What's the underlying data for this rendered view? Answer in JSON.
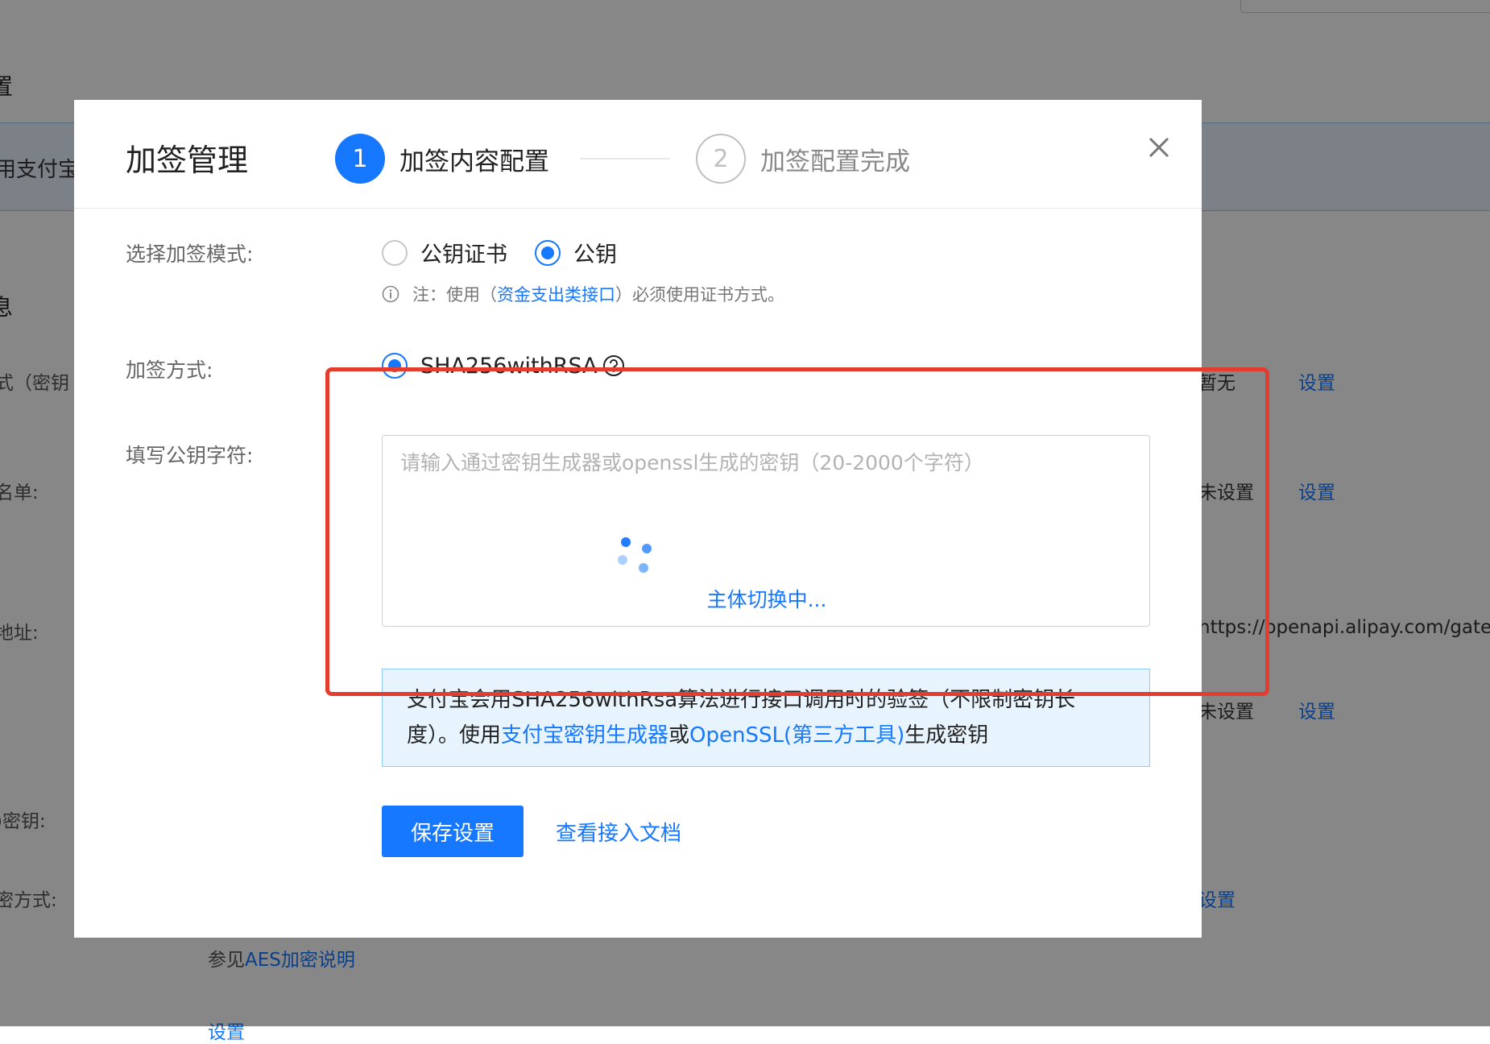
{
  "background": {
    "title_fragment": "置",
    "banner_text": "用支付宝",
    "section_fragment": "息",
    "rows": [
      {
        "label": "式（密钥",
        "value": "暂无",
        "action": "设置"
      },
      {
        "label": "名单:",
        "value": "未设置",
        "action": "设置"
      },
      {
        "label": "地址:",
        "value": "https://openapi.alipay.com/gateway"
      },
      {
        "label": "",
        "value": "未设置",
        "action": "设置"
      },
      {
        "label": ")密钥:"
      },
      {
        "label": "密方式:",
        "action": "设置"
      }
    ],
    "aes_note_prefix": "参见",
    "aes_note_link": "AES加密说明",
    "bottom_fragment": "设置"
  },
  "modal": {
    "title": "加签管理",
    "steps": [
      {
        "number": "1",
        "label": "加签内容配置"
      },
      {
        "number": "2",
        "label": "加签配置完成"
      }
    ],
    "close_icon": "close-icon",
    "mode": {
      "label": "选择加签模式:",
      "options": [
        "公钥证书",
        "公钥"
      ],
      "selected": "公钥"
    },
    "note": {
      "prefix": "注：使用（",
      "link": "资金支出类接口",
      "suffix": "）必须使用证书方式。"
    },
    "method": {
      "label": "加签方式:",
      "option": "SHA256withRSA"
    },
    "pubkey": {
      "label": "填写公钥字符:",
      "placeholder": "请输入通过密钥生成器或openssl生成的密钥（20-2000个字符）",
      "value": "",
      "loading_text": "主体切换中..."
    },
    "info": {
      "text1": "支付宝会用SHA256withRsa算法进行接口调用时的验签（不限制密钥长度）。使用",
      "link1": "支付宝密钥生成器",
      "text2": "或",
      "link2": "OpenSSL(第三方工具)",
      "text3": "生成密钥"
    },
    "save_button": "保存设置",
    "doc_link": "查看接入文档"
  },
  "colors": {
    "primary": "#1677ff",
    "highlight": "#e33d2f",
    "info_bg": "#e8f4fd"
  }
}
